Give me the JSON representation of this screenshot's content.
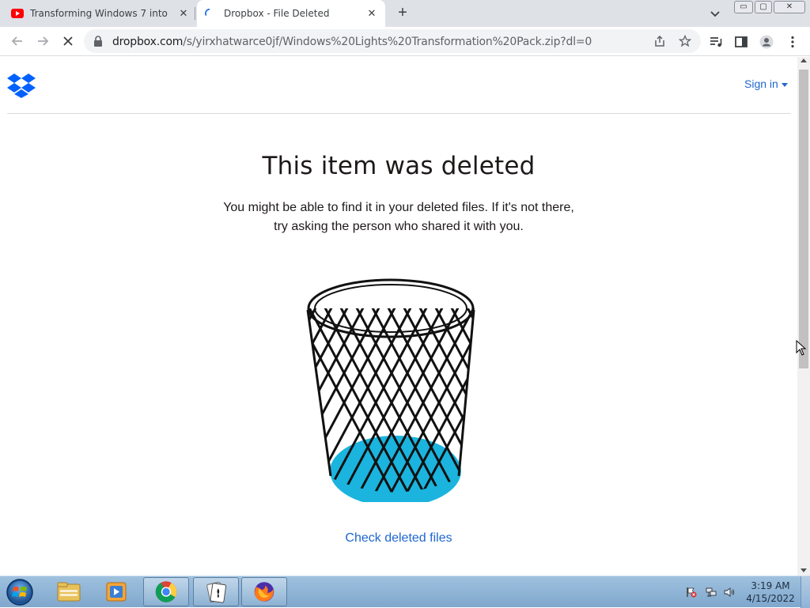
{
  "browser": {
    "tabs": [
      {
        "title": "Transforming Windows 7 into Wi",
        "favicon": "youtube-icon",
        "active": false
      },
      {
        "title": "Dropbox - File Deleted",
        "favicon": "loading-spinner-icon",
        "active": true
      }
    ],
    "new_tab_label": "+",
    "close_glyph": "✕",
    "address": {
      "domain": "dropbox.com",
      "path": "/s/yirxhatwarce0jf/Windows%20Lights%20Transformation%20Pack.zip?dl=0"
    },
    "window_controls": {
      "minimize": "▭",
      "maximize": "▢",
      "close": "✕"
    }
  },
  "page": {
    "brand": "dropbox-logo-icon",
    "sign_in_label": "Sign in",
    "heading": "This item was deleted",
    "message_line1": "You might be able to find it in your deleted files. If it's not there,",
    "message_line2": "try asking the person who shared it with you.",
    "illustration": "wastebasket-illustration",
    "check_link": "Check deleted files"
  },
  "taskbar": {
    "apps": [
      "windows-explorer-icon",
      "media-player-icon",
      "chrome-icon",
      "solitaire-icon",
      "firefox-icon"
    ],
    "clock_time": "3:19 AM",
    "clock_date": "4/15/2022"
  },
  "colors": {
    "link": "#1e66d0",
    "heading": "#1e1919",
    "dropbox_blue": "#0061fe",
    "basket_fill": "#1ab4de"
  }
}
